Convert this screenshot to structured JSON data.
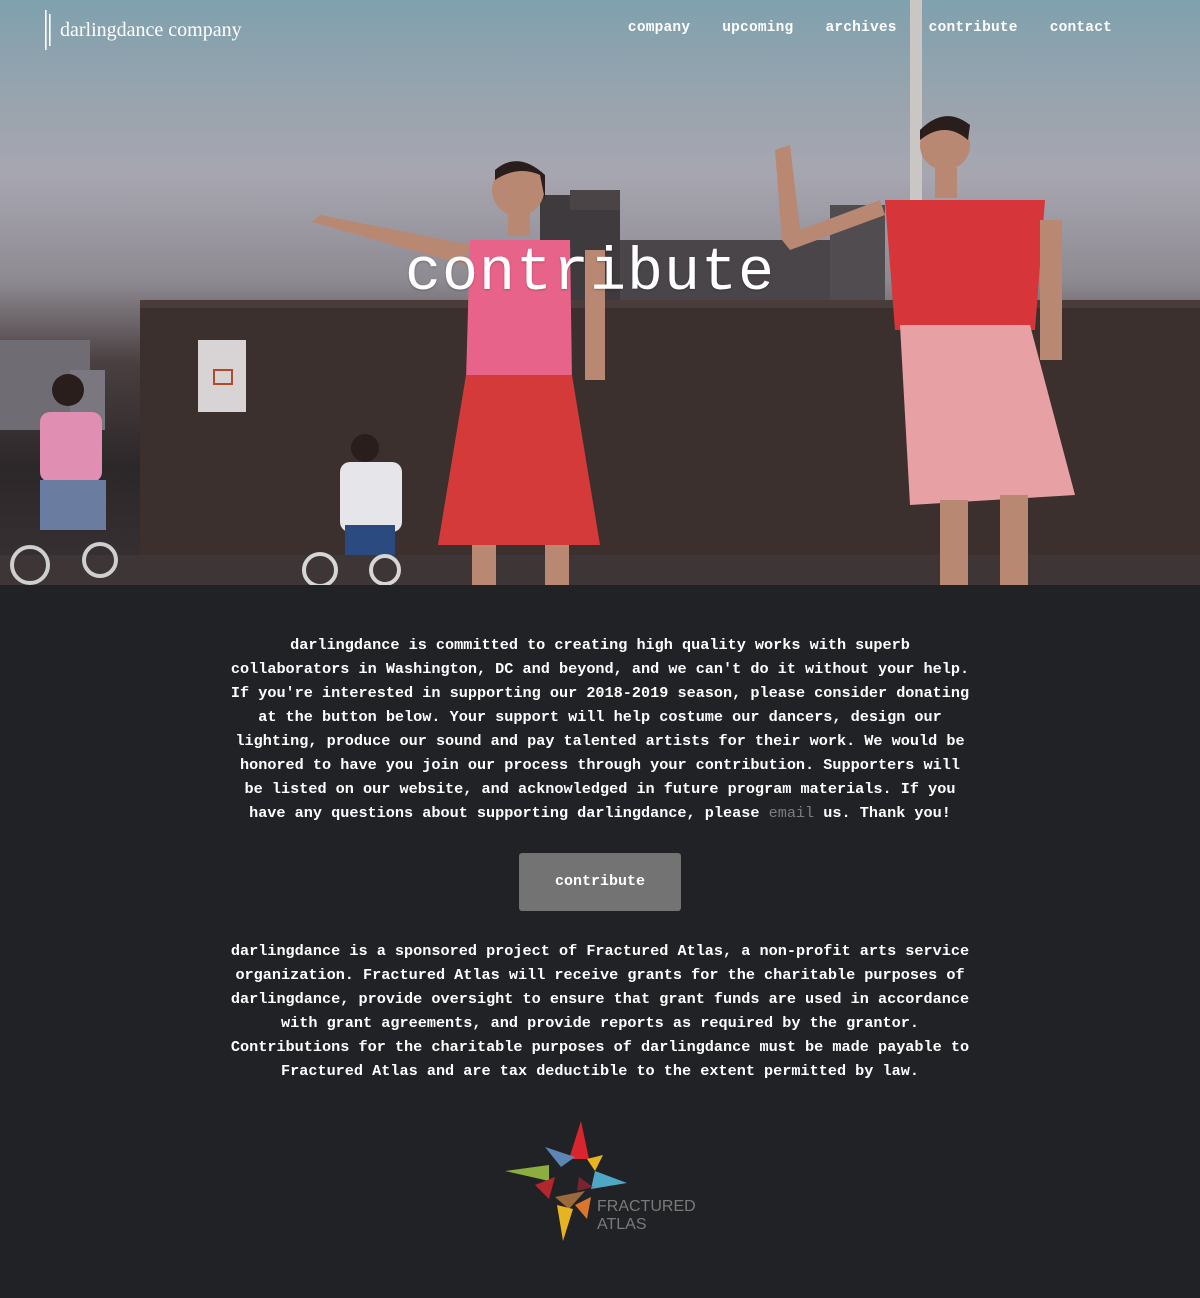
{
  "header": {
    "logo_text": "darlingdance company",
    "nav": [
      {
        "label": "company"
      },
      {
        "label": "upcoming"
      },
      {
        "label": "archives"
      },
      {
        "label": "contribute"
      },
      {
        "label": "contact"
      }
    ]
  },
  "hero": {
    "title": "contribute"
  },
  "main": {
    "intro_before_link": "darlingdance is committed to creating high quality works with superb collaborators in Washington, DC and beyond, and we can't do it without your help. If you're interested in supporting our 2018-2019 season, please consider donating at the button below. Your support will help costume our dancers, design our lighting, produce our sound and pay talented artists for their work. We would be honored to have you join our process through your contribution. Supporters will be listed on our website, and acknowledged in future program materials. If you have any questions about supporting darlingdance, please",
    "email_link": "email",
    "intro_after_link": "us. Thank you!",
    "button_label": "contribute",
    "sponsor_text": "darlingdance is a sponsored project of Fractured Atlas, a non-profit arts service organization. Fractured Atlas will receive grants for the charitable purposes of darlingdance, provide oversight to ensure that grant funds are used in accordance with grant agreements, and provide reports as required by the grantor. Contributions for the charitable purposes of darlingdance must be made payable to Fractured Atlas and are tax deductible to the extent permitted by law.",
    "sponsor_logo": {
      "line1": "FRACTURED",
      "line2": "ATLAS"
    }
  },
  "colors": {
    "page_background": "#212225",
    "button_background": "#737373",
    "link_color": "#7d7d7d",
    "text": "#ffffff"
  }
}
